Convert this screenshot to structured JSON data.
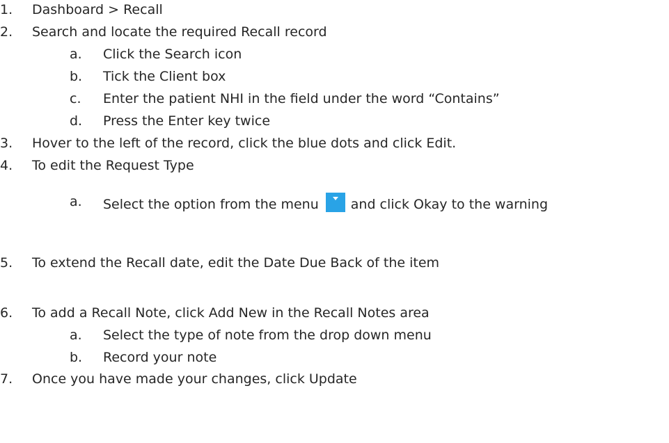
{
  "steps": [
    {
      "num": "1.",
      "text": "Dashboard > Recall"
    },
    {
      "num": "2.",
      "text": "Search and locate the required Recall record",
      "substeps": [
        {
          "letter": "a.",
          "text": "Click the Search icon"
        },
        {
          "letter": "b.",
          "text": "Tick the Client box"
        },
        {
          "letter": "c.",
          "text": "Enter the patient NHI in the field under the word “Contains”"
        },
        {
          "letter": "d.",
          "text": "Press the Enter key twice"
        }
      ]
    },
    {
      "num": "3.",
      "text": "Hover to the left of the record, click the blue dots and click Edit."
    },
    {
      "num": "4.",
      "text": "To edit the Request Type",
      "substeps": [
        {
          "letter": "a.",
          "text_before": "Select the option from the menu",
          "icon": "dropdown-arrow-icon",
          "text_after": "and click Okay to the warning"
        }
      ]
    },
    {
      "num": "5.",
      "text": "To extend the Recall date, edit the Date Due Back of the item"
    },
    {
      "num": "6.",
      "text": "To add a Recall Note, click Add New in the Recall Notes area",
      "substeps": [
        {
          "letter": "a.",
          "text": "Select the type of note from the drop down menu"
        },
        {
          "letter": "b.",
          "text": "Record your note"
        }
      ]
    },
    {
      "num": "7.",
      "text": "Once you have made your changes, click Update"
    }
  ],
  "colors": {
    "text": "#262626",
    "icon_bg": "#29a3e6"
  }
}
